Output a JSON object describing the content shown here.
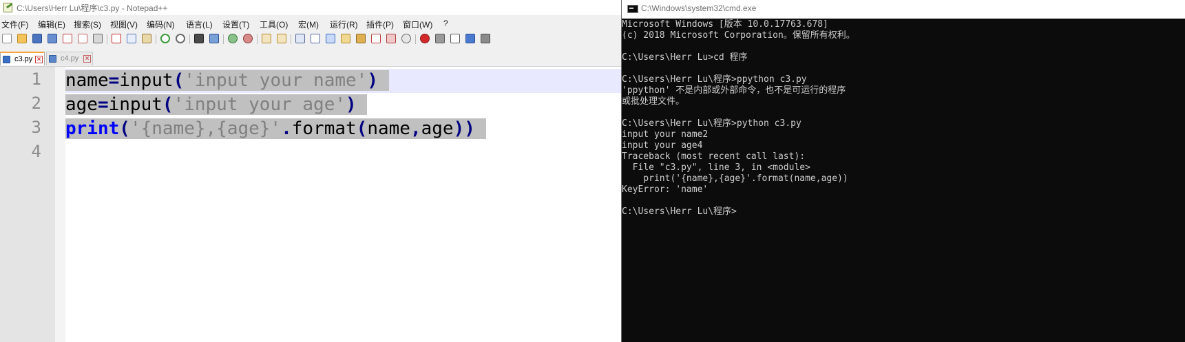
{
  "notepad": {
    "title": "C:\\Users\\Herr Lu\\程序\\c3.py - Notepad++",
    "menu": [
      "文件(F)",
      "编辑(E)",
      "搜索(S)",
      "视图(V)",
      "编码(N)",
      "语言(L)",
      "设置(T)",
      "工具(O)",
      "宏(M)",
      "运行(R)",
      "插件(P)",
      "窗口(W)",
      "?"
    ],
    "toolbar_icons": [
      "new-file-icon",
      "open-file-icon",
      "save-icon",
      "save-all-icon",
      "close-icon",
      "close-all-icon",
      "print-icon",
      "cut-icon",
      "copy-icon",
      "paste-icon",
      "undo-icon",
      "redo-icon",
      "find-icon",
      "replace-icon",
      "zoom-in-icon",
      "zoom-out-icon",
      "sync-vertical-icon",
      "sync-horizontal-icon",
      "word-wrap-icon",
      "show-all-characters-icon",
      "indent-guide-icon",
      "user-language-icon",
      "document-map-icon",
      "function-list-icon",
      "folder-as-workspace-icon",
      "monitoring-icon",
      "macro-record-icon",
      "macro-stop-icon",
      "macro-play-icon",
      "macro-run-multiple-icon",
      "macro-save-icon"
    ],
    "tabs": [
      {
        "label": "c3.py",
        "active": true
      },
      {
        "label": "c4.py",
        "active": false
      }
    ],
    "code": {
      "lines": [
        "1",
        "2",
        "3",
        "4"
      ],
      "line1": {
        "a": "name",
        "b": "=",
        "c": "input",
        "d": "(",
        "e": "'input your name'",
        "f": ")"
      },
      "line2": {
        "a": "age",
        "b": "=",
        "c": "input",
        "d": "(",
        "e": "'input your age'",
        "f": ")"
      },
      "line3": {
        "a": "print",
        "b": "(",
        "c": "'{name},{age}'",
        "d": ".",
        "e": "format",
        "f": "(",
        "g": "name",
        "h": ",",
        "i": "age",
        "j": ")",
        "k": ")"
      }
    }
  },
  "cmd": {
    "title": "C:\\Windows\\system32\\cmd.exe",
    "lines": [
      "Microsoft Windows [版本 10.0.17763.678]",
      "(c) 2018 Microsoft Corporation。保留所有权利。",
      "",
      "C:\\Users\\Herr Lu>cd 程序",
      "",
      "C:\\Users\\Herr Lu\\程序>ppython c3.py",
      "'ppython' 不是内部或外部命令，也不是可运行的程序",
      "或批处理文件。",
      "",
      "C:\\Users\\Herr Lu\\程序>python c3.py",
      "input your name2",
      "input your age4",
      "Traceback (most recent call last):",
      "  File \"c3.py\", line 3, in <module>",
      "    print('{name},{age}'.format(name,age))",
      "KeyError: 'name'",
      "",
      "C:\\Users\\Herr Lu\\程序>"
    ]
  },
  "colors": {
    "console_bg": "#0c0c0c",
    "console_text": "#cccccc",
    "keyword": "#0000ff",
    "operator": "#000080",
    "string": "#808080",
    "selection": "#c0c0c0",
    "current_line": "#e8e8ff"
  }
}
